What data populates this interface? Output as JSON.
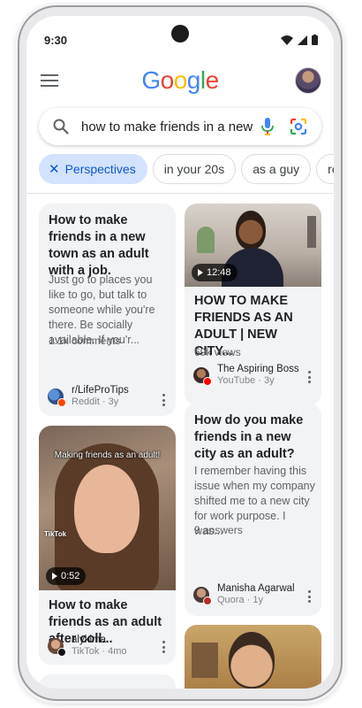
{
  "status": {
    "time": "9:30"
  },
  "header": {
    "logo_letters": [
      {
        "ch": "G",
        "color": "#4285F4"
      },
      {
        "ch": "o",
        "color": "#EA4335"
      },
      {
        "ch": "o",
        "color": "#FBBC05"
      },
      {
        "ch": "g",
        "color": "#4285F4"
      },
      {
        "ch": "l",
        "color": "#34A853"
      },
      {
        "ch": "e",
        "color": "#EA4335"
      }
    ]
  },
  "search": {
    "query": "how to make friends in a new"
  },
  "chips": {
    "perspectives": "Perspectives",
    "in_your_20s": "in your 20s",
    "as_a_guy": "as a guy",
    "partial": "re"
  },
  "cards": {
    "reddit": {
      "title": "How to make friends in a new town as an adult with a job.",
      "snippet": "Just go to places you like to go, but talk to someone while you're there. Be socially available. If you'r...",
      "stat": "1.1k comments",
      "source_name": "r/LifeProTips",
      "source_sub": "Reddit · 3y"
    },
    "youtube": {
      "duration": "12:48",
      "title": "HOW TO MAKE FRIENDS AS AN ADULT | NEW CITY...",
      "stat": "69k views",
      "source_name": "The Aspiring Boss",
      "source_sub": "YouTube · 3y"
    },
    "tiktok": {
      "overlay_text": "Making friends as an adult!",
      "watermark": "TikTok",
      "duration": "0:52",
      "title": "How to make friends as an adult after coll...",
      "source_name": "alykima",
      "source_sub": "TikTok · 4mo"
    },
    "quora": {
      "title": "How do you make friends in a new city as an adult?",
      "snippet": "I remember having this issue when my company shifted me to a new city for work purpose. I was...",
      "stat": "9 answers",
      "source_name": "Manisha Agarwal",
      "source_sub": "Quora · 1y"
    }
  },
  "colors": {
    "chip_active_bg": "#d3e3fd",
    "chip_active_text": "#0b57d0",
    "card_bg": "#f1f3f4",
    "reddit": "#FF4500",
    "youtube": "#FF0000",
    "quora": "#B92B27"
  }
}
